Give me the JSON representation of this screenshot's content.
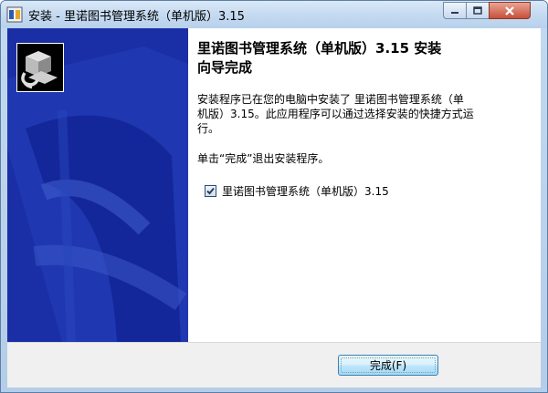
{
  "window": {
    "title": "安装 - 里诺图书管理系统（单机版）3.15"
  },
  "wizard": {
    "heading_line1": "里诺图书管理系统（单机版）3.15 安装",
    "heading_line2": "向导完成",
    "paragraph1_line1": "安装程序已在您的电脑中安装了 里诺图书管理系统（单",
    "paragraph1_line2": "机版）3.15。此应用程序可以通过选择安装的快捷方式运",
    "paragraph1_line3": "行。",
    "paragraph2": "单击“完成”退出安装程序。",
    "checkbox_label": "里诺图书管理系统（单机版）3.15",
    "checkbox_checked": true
  },
  "footer": {
    "finish_label": "完成(F)"
  },
  "icons": [
    "installer-app-icon",
    "minimize-icon",
    "maximize-icon",
    "close-icon",
    "setup-computer-icon",
    "check-icon"
  ],
  "colors": {
    "banner_blue": "#1a2fa6",
    "close_red": "#c7503a",
    "titlebar": "#c5daf0"
  }
}
